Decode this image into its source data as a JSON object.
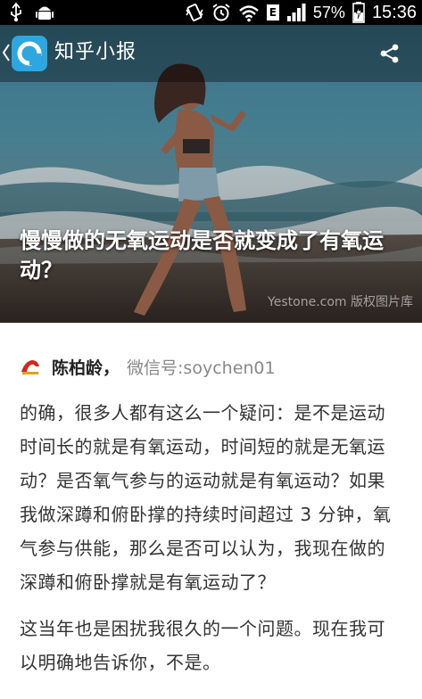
{
  "status_bar": {
    "battery_percent": "57%",
    "time": "15:36",
    "network_badge": "E",
    "icons": [
      "usb-icon",
      "android-icon",
      "vibrate-icon",
      "alarm-icon",
      "wifi-icon",
      "signal-icon",
      "battery-charging-icon"
    ]
  },
  "app_bar": {
    "title": "知乎小报",
    "icons": [
      "back-chevron-icon",
      "app-logo-icon",
      "share-icon"
    ]
  },
  "hero": {
    "headline": "慢慢做的无氧运动是否就变成了有氧运动？",
    "watermark": "Yestone.com 版权图片库"
  },
  "author": {
    "name": "陈柏龄",
    "separator": "，",
    "bio": "微信号:soychen01"
  },
  "article": {
    "paragraphs": [
      "的确，很多人都有这么一个疑问：是不是运动时间长的就是有氧运动，时间短的就是无氧运动？是否氧气参与的运动就是有氧运动？如果我做深蹲和俯卧撑的持续时间超过 3 分钟，氧气参与供能，那么是否可以认为，我现在做的深蹲和俯卧撑就是有氧运动了？",
      "这当年也是困扰我很久的一个问题。现在我可以明确地告诉你，不是。"
    ]
  },
  "colors": {
    "status_bar_bg": "#000000",
    "app_logo": "#2ea7e0",
    "text_primary": "#333333",
    "text_muted": "#888888"
  }
}
